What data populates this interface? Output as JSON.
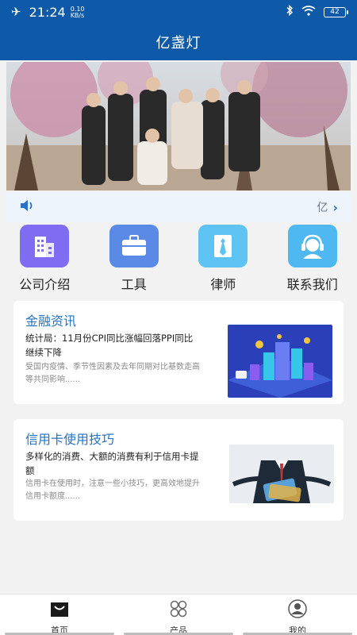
{
  "status_bar": {
    "time": "21:24",
    "net_speed_value": "0.10",
    "net_speed_unit": "KB/s",
    "battery": "42",
    "icons": [
      "airplane-icon",
      "bluetooth-icon",
      "wifi-icon",
      "battery-icon"
    ]
  },
  "header": {
    "title": "亿盏灯"
  },
  "notice": {
    "text": "亿"
  },
  "grid": [
    {
      "label": "公司介绍",
      "icon": "building-icon",
      "color": "#7f6cf2"
    },
    {
      "label": "工具",
      "icon": "toolbox-icon",
      "color": "#5a89e6"
    },
    {
      "label": "律师",
      "icon": "tie-icon",
      "color": "#5ec3f2"
    },
    {
      "label": "联系我们",
      "icon": "customer-service-icon",
      "color": "#4fb8f0"
    }
  ],
  "articles": [
    {
      "category": "金融资讯",
      "headline": "统计局：11月份CPI同比涨幅回落PPI同比继续下降",
      "summary": "受国内疫情、季节性因素及去年同期对比基数走高等共同影响......"
    },
    {
      "category": "信用卡使用技巧",
      "headline": "多样化的消费、大额的消费有利于信用卡提额",
      "summary": "信用卡在使用时，注意一些小技巧，更高效地提升信用卡额度......"
    }
  ],
  "tabs": [
    {
      "label": "首页",
      "icon": "home-icon"
    },
    {
      "label": "产品",
      "icon": "grid-icon"
    },
    {
      "label": "我的",
      "icon": "user-icon"
    }
  ],
  "colors": {
    "header_bg": "#0f5aa8",
    "accent": "#2673c2",
    "notice_bg": "#eef4fb"
  }
}
